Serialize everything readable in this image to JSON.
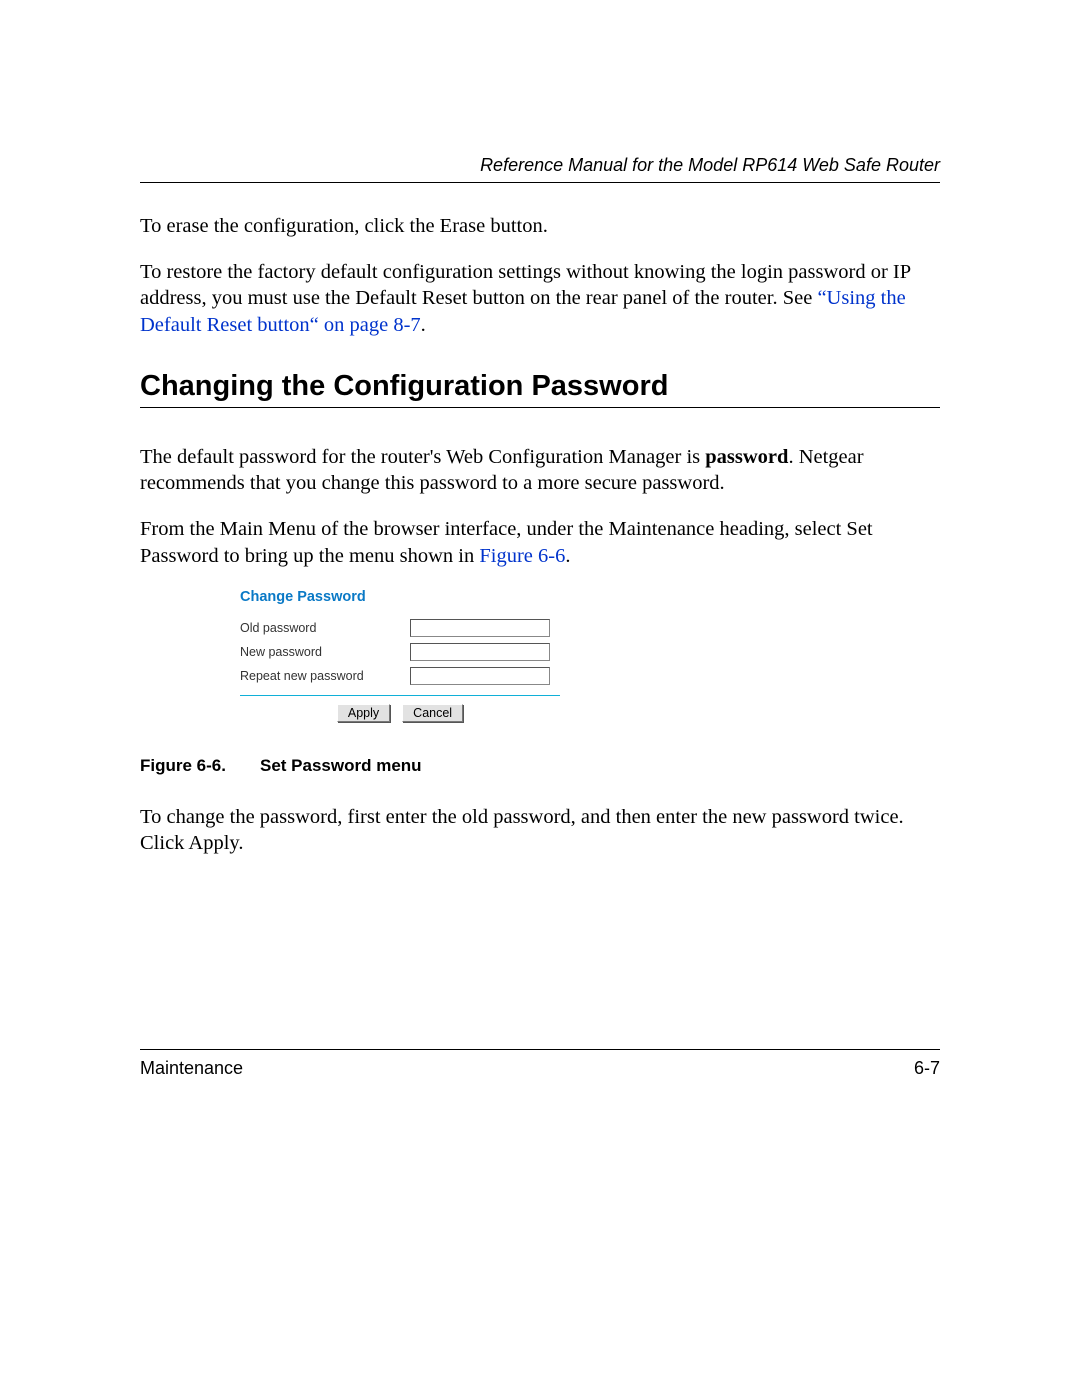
{
  "header": {
    "running_title": "Reference Manual for the Model RP614 Web Safe Router"
  },
  "intro": {
    "p1": "To erase the configuration, click the Erase button.",
    "p2a": "To restore the factory default configuration settings without knowing the login password or IP address, you must use the Default Reset button on the rear panel of the router. See ",
    "p2_link": "“Using the Default Reset button“ on page 8-7",
    "p2b": "."
  },
  "section": {
    "heading": "Changing the Configuration Password",
    "p1a": "The default password for the router's Web Configuration Manager is ",
    "p1_bold": "password",
    "p1b": ". Netgear recommends that you change this password to a more secure password.",
    "p2a": "From the Main Menu of the browser interface, under the Maintenance heading, select Set Password to bring up the menu shown in ",
    "p2_link": "Figure 6-6",
    "p2b": "."
  },
  "figure": {
    "title": "Change Password",
    "labels": {
      "old": "Old password",
      "new": "New password",
      "repeat": "Repeat new password"
    },
    "buttons": {
      "apply": "Apply",
      "cancel": "Cancel"
    },
    "caption_num": "Figure 6-6.",
    "caption_text": "Set Password menu"
  },
  "after_figure": {
    "p1": "To change the password, first enter the old password, and then enter the new password twice. Click Apply."
  },
  "footer": {
    "left": "Maintenance",
    "right": "6-7"
  }
}
